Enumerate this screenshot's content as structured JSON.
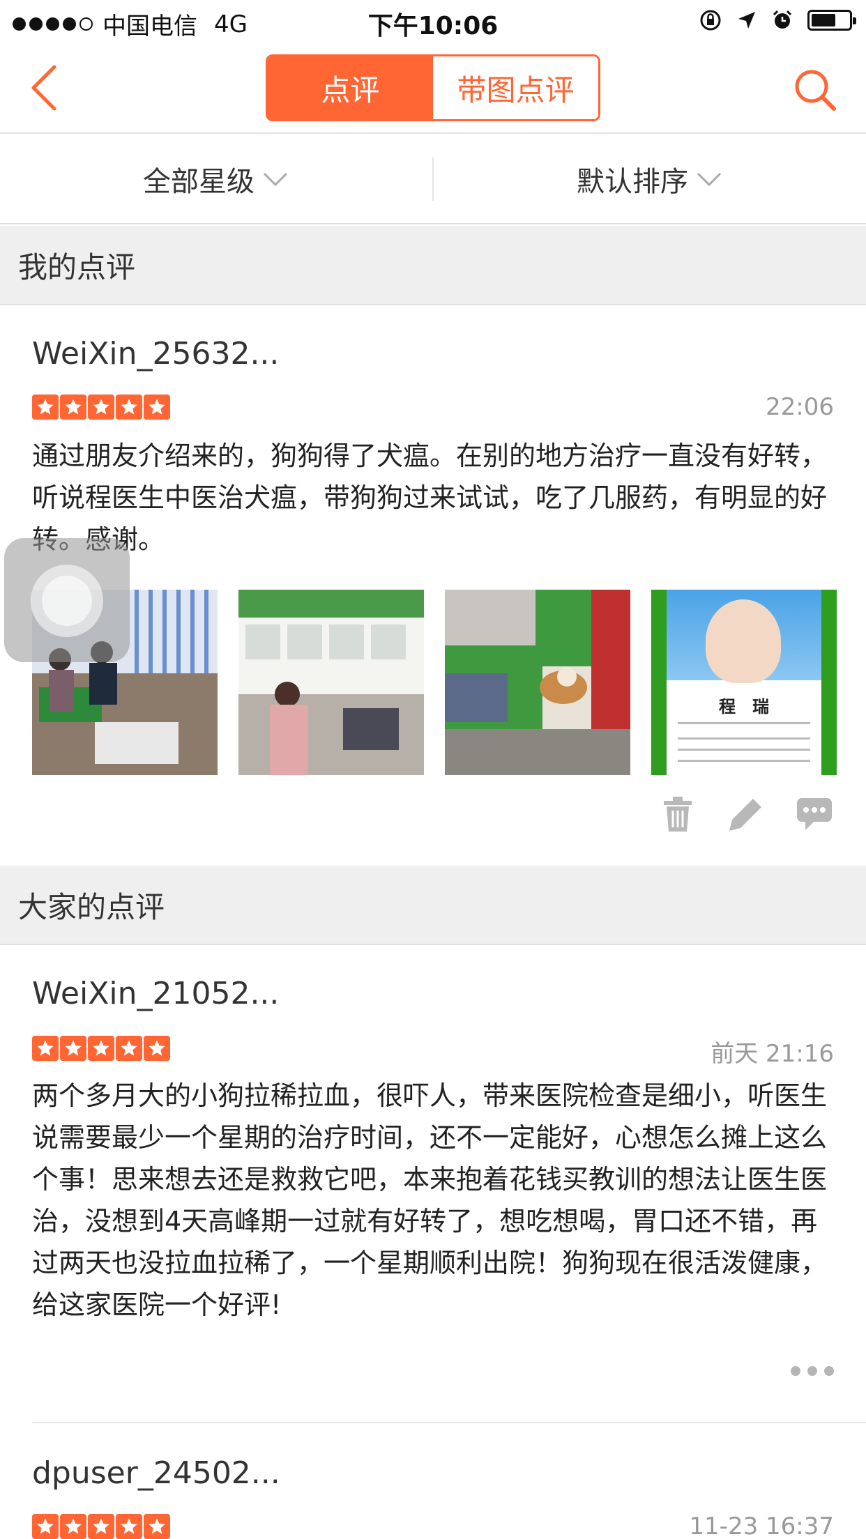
{
  "status_bar": {
    "carrier": "中国电信",
    "network": "4G",
    "time": "下午10:06"
  },
  "nav": {
    "tabs": [
      {
        "label": "点评",
        "active": true
      },
      {
        "label": "带图点评",
        "active": false
      }
    ],
    "accent_color": "#ff6633"
  },
  "filters": {
    "star_filter": "全部星级",
    "sort": "默认排序"
  },
  "my_reviews": {
    "section_title": "我的点评",
    "review": {
      "user": "WeiXin_25632...",
      "rating": 5,
      "time": "22:06",
      "text": "通过朋友介绍来的，狗狗得了犬瘟。在别的地方治疗一直没有好转，听说程医生中医治犬瘟，带狗狗过来试试，吃了几服药，有明显的好转。感谢。",
      "photo4_name": "程　瑞"
    }
  },
  "all_reviews": {
    "section_title": "大家的点评",
    "reviews": [
      {
        "user": "WeiXin_21052...",
        "rating": 5,
        "time": "前天 21:16",
        "text": "两个多月大的小狗拉稀拉血，很吓人，带来医院检查是细小，听医生说需要最少一个星期的治疗时间，还不一定能好，心想怎么摊上这么个事！思来想去还是救救它吧，本来抱着花钱买教训的想法让医生医治，没想到4天高峰期一过就有好转了，想吃想喝，胃口还不错，再过两天也没拉血拉稀了，一个星期顺利出院！狗狗现在很活泼健康，给这家医院一个好评!"
      },
      {
        "user": "dpuser_24502...",
        "rating": 5,
        "time": "11-23 16:37"
      }
    ]
  }
}
